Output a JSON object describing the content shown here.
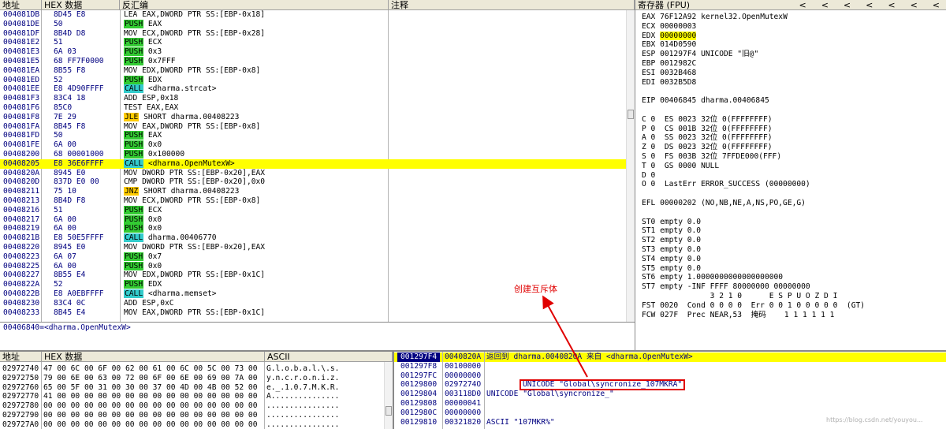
{
  "colors": {
    "highlight": "#ffff00",
    "push": "#33cc33",
    "call": "#33cccc",
    "jump": "#ffcc00",
    "changed": "#e00000",
    "annotation": "#e00000",
    "selected_stack": "#000080"
  },
  "cpu": {
    "headers": [
      "地址",
      "HEX 数据",
      "反汇编",
      "注释"
    ],
    "rows": [
      {
        "addr": "004081DB",
        "hex": "8D45 E8",
        "kw": "",
        "rest": "LEA EAX,DWORD PTR SS:[EBP-0x18]",
        "t": ""
      },
      {
        "addr": "004081DE",
        "hex": "50",
        "kw": "PUSH",
        "rest": " EAX",
        "t": "push"
      },
      {
        "addr": "004081DF",
        "hex": "8B4D D8",
        "kw": "",
        "rest": "MOV ECX,DWORD PTR SS:[EBP-0x28]",
        "t": ""
      },
      {
        "addr": "004081E2",
        "hex": "51",
        "kw": "PUSH",
        "rest": " ECX",
        "t": "push"
      },
      {
        "addr": "004081E3",
        "hex": "6A 03",
        "kw": "PUSH",
        "rest": " 0x3",
        "t": "push"
      },
      {
        "addr": "004081E5",
        "hex": "68 FF7F0000",
        "kw": "PUSH",
        "rest": " 0x7FFF",
        "t": "push"
      },
      {
        "addr": "004081EA",
        "hex": "8B55 F8",
        "kw": "",
        "rest": "MOV EDX,DWORD PTR SS:[EBP-0x8]",
        "t": ""
      },
      {
        "addr": "004081ED",
        "hex": "52",
        "kw": "PUSH",
        "rest": " EDX",
        "t": "push"
      },
      {
        "addr": "004081EE",
        "hex": "E8 4D90FFFF",
        "kw": "CALL",
        "rest": " <dharma.strcat>",
        "t": "call"
      },
      {
        "addr": "004081F3",
        "hex": "83C4 18",
        "kw": "",
        "rest": "ADD ESP,0x18",
        "t": ""
      },
      {
        "addr": "004081F6",
        "hex": "85C0",
        "kw": "",
        "rest": "TEST EAX,EAX",
        "t": ""
      },
      {
        "addr": "004081F8",
        "hex": "7E 29",
        "kw": "JLE",
        "rest": " SHORT dharma.00408223",
        "t": "jump"
      },
      {
        "addr": "004081FA",
        "hex": "8B45 F8",
        "kw": "",
        "rest": "MOV EAX,DWORD PTR SS:[EBP-0x8]",
        "t": ""
      },
      {
        "addr": "004081FD",
        "hex": "50",
        "kw": "PUSH",
        "rest": " EAX",
        "t": "push"
      },
      {
        "addr": "004081FE",
        "hex": "6A 00",
        "kw": "PUSH",
        "rest": " 0x0",
        "t": "push"
      },
      {
        "addr": "00408200",
        "hex": "68 00001000",
        "kw": "PUSH",
        "rest": " 0x100000",
        "t": "push"
      },
      {
        "addr": "00408205",
        "hex": "E8 36E6FFFF",
        "kw": "CALL",
        "rest": " <dharma.OpenMutexW>",
        "t": "call",
        "sel": true
      },
      {
        "addr": "0040820A",
        "hex": "8945 E0",
        "kw": "",
        "rest": "MOV DWORD PTR SS:[EBP-0x20],EAX",
        "t": ""
      },
      {
        "addr": "0040820D",
        "hex": "837D E0 00",
        "kw": "",
        "rest": "CMP DWORD PTR SS:[EBP-0x20],0x0",
        "t": ""
      },
      {
        "addr": "00408211",
        "hex": "75 10",
        "kw": "JNZ",
        "rest": " SHORT dharma.00408223",
        "t": "jump"
      },
      {
        "addr": "00408213",
        "hex": "8B4D F8",
        "kw": "",
        "rest": "MOV ECX,DWORD PTR SS:[EBP-0x8]",
        "t": ""
      },
      {
        "addr": "00408216",
        "hex": "51",
        "kw": "PUSH",
        "rest": " ECX",
        "t": "push"
      },
      {
        "addr": "00408217",
        "hex": "6A 00",
        "kw": "PUSH",
        "rest": " 0x0",
        "t": "push"
      },
      {
        "addr": "00408219",
        "hex": "6A 00",
        "kw": "PUSH",
        "rest": " 0x0",
        "t": "push"
      },
      {
        "addr": "0040821B",
        "hex": "E8 50E5FFFF",
        "kw": "CALL",
        "rest": " dharma.00406770",
        "t": "call"
      },
      {
        "addr": "00408220",
        "hex": "8945 E0",
        "kw": "",
        "rest": "MOV DWORD PTR SS:[EBP-0x20],EAX",
        "t": ""
      },
      {
        "addr": "00408223",
        "hex": "6A 07",
        "kw": "PUSH",
        "rest": " 0x7",
        "t": "push"
      },
      {
        "addr": "00408225",
        "hex": "6A 00",
        "kw": "PUSH",
        "rest": " 0x0",
        "t": "push"
      },
      {
        "addr": "00408227",
        "hex": "8B55 E4",
        "kw": "",
        "rest": "MOV EDX,DWORD PTR SS:[EBP-0x1C]",
        "t": ""
      },
      {
        "addr": "0040822A",
        "hex": "52",
        "kw": "PUSH",
        "rest": " EDX",
        "t": "push"
      },
      {
        "addr": "0040822B",
        "hex": "E8 A0EBFFFF",
        "kw": "CALL",
        "rest": " <dharma.memset>",
        "t": "call"
      },
      {
        "addr": "00408230",
        "hex": "83C4 0C",
        "kw": "",
        "rest": "ADD ESP,0xC",
        "t": ""
      },
      {
        "addr": "00408233",
        "hex": "8B45 E4",
        "kw": "",
        "rest": "MOV EAX,DWORD PTR SS:[EBP-0x1C]",
        "t": ""
      }
    ]
  },
  "info": {
    "text": "00406840=<dharma.OpenMutexW>"
  },
  "registers": {
    "title": "寄存器 (FPU)",
    "nav": [
      "<",
      "<",
      "<",
      "<",
      "<",
      "<",
      "<"
    ],
    "lines": [
      {
        "parts": [
          {
            "t": "EAX "
          },
          {
            "t": "76F12A92",
            "c": "changed"
          },
          {
            "t": " kernel32.OpenMutexW"
          }
        ]
      },
      {
        "parts": [
          {
            "t": "ECX 00000003"
          }
        ]
      },
      {
        "parts": [
          {
            "t": "EDX "
          },
          {
            "t": "00000000",
            "c": "hl"
          }
        ]
      },
      {
        "parts": [
          {
            "t": "EBX 014D0590"
          }
        ]
      },
      {
        "parts": [
          {
            "t": "ESP 001297F4 UNICODE \"旧@\""
          }
        ]
      },
      {
        "parts": [
          {
            "t": "EBP 0012982C"
          }
        ]
      },
      {
        "parts": [
          {
            "t": "ESI 0032B468"
          }
        ]
      },
      {
        "parts": [
          {
            "t": "EDI 0032B5D8"
          }
        ]
      },
      {
        "parts": [
          {
            "t": ""
          }
        ]
      },
      {
        "parts": [
          {
            "t": "EIP "
          },
          {
            "t": "00406845",
            "c": "changed"
          },
          {
            "t": " dharma.00406845"
          }
        ]
      },
      {
        "parts": [
          {
            "t": ""
          }
        ]
      },
      {
        "parts": [
          {
            "t": "C 0  ES 0023 32位 0(FFFFFFFF)"
          }
        ]
      },
      {
        "parts": [
          {
            "t": "P 0  CS 001B 32位 0(FFFFFFFF)"
          }
        ]
      },
      {
        "parts": [
          {
            "t": "A 0  SS 0023 32位 0(FFFFFFFF)"
          }
        ]
      },
      {
        "parts": [
          {
            "t": "Z 0  DS 0023 32位 0(FFFFFFFF)"
          }
        ]
      },
      {
        "parts": [
          {
            "t": "S 0  FS 003B 32位 7FFDE000(FFF)"
          }
        ]
      },
      {
        "parts": [
          {
            "t": "T 0  GS 0000 NULL"
          }
        ]
      },
      {
        "parts": [
          {
            "t": "D 0"
          }
        ]
      },
      {
        "parts": [
          {
            "t": "O 0  LastErr ERROR_SUCCESS (00000000)"
          }
        ]
      },
      {
        "parts": [
          {
            "t": ""
          }
        ]
      },
      {
        "parts": [
          {
            "t": "EFL 00000202 (NO,NB,NE,A,NS,PO,GE,G)"
          }
        ]
      },
      {
        "parts": [
          {
            "t": ""
          }
        ]
      },
      {
        "parts": [
          {
            "t": "ST0 empty 0.0"
          }
        ]
      },
      {
        "parts": [
          {
            "t": "ST1 empty 0.0"
          }
        ]
      },
      {
        "parts": [
          {
            "t": "ST2 empty 0.0"
          }
        ]
      },
      {
        "parts": [
          {
            "t": "ST3 empty 0.0"
          }
        ]
      },
      {
        "parts": [
          {
            "t": "ST4 empty 0.0"
          }
        ]
      },
      {
        "parts": [
          {
            "t": "ST5 empty 0.0"
          }
        ]
      },
      {
        "parts": [
          {
            "t": "ST6 empty 1.0000000000000000000"
          }
        ]
      },
      {
        "parts": [
          {
            "t": "ST7 empty -INF FFFF 80000000 00000000"
          }
        ]
      },
      {
        "parts": [
          {
            "t": "               3 2 1 0      E S P U O Z D I"
          }
        ]
      },
      {
        "parts": [
          {
            "t": "FST 0020  Cond 0 0 0 0  Err 0 0 1 0 0 0 0 0  (GT)"
          }
        ]
      },
      {
        "parts": [
          {
            "t": "FCW 027F  Prec NEAR,53  掩码    1 1 1 1 1 1"
          }
        ]
      }
    ]
  },
  "dump": {
    "headers": [
      "地址",
      "HEX 数据",
      "ASCII"
    ],
    "rows": [
      {
        "addr": "02972740",
        "hex": "47 00 6C 00 6F 00 62 00 61 00 6C 00 5C 00 73 00",
        "ascii": "G.l.o.b.a.l.\\.s."
      },
      {
        "addr": "02972750",
        "hex": "79 00 6E 00 63 00 72 00 6F 00 6E 00 69 00 7A 00",
        "ascii": "y.n.c.r.o.n.i.z."
      },
      {
        "addr": "02972760",
        "hex": "65 00 5F 00 31 00 30 00 37 00 4D 00 4B 00 52 00",
        "ascii": "e._.1.0.7.M.K.R."
      },
      {
        "addr": "02972770",
        "hex": "41 00 00 00 00 00 00 00 00 00 00 00 00 00 00 00",
        "ascii": "A..............."
      },
      {
        "addr": "02972780",
        "hex": "00 00 00 00 00 00 00 00 00 00 00 00 00 00 00 00",
        "ascii": "................"
      },
      {
        "addr": "02972790",
        "hex": "00 00 00 00 00 00 00 00 00 00 00 00 00 00 00 00",
        "ascii": "................"
      },
      {
        "addr": "029727A0",
        "hex": "00 00 00 00 00 00 00 00 00 00 00 00 00 00 00 00",
        "ascii": "................"
      }
    ]
  },
  "stack": {
    "rows": [
      {
        "addr": "001297F4",
        "val": "0040820A",
        "cmt": "返回到 dharma.0040820A 来自 <dharma.OpenMutexW>",
        "sel": true
      },
      {
        "addr": "001297F8",
        "val": "00100000",
        "cmt": ""
      },
      {
        "addr": "001297FC",
        "val": "00000000",
        "cmt": ""
      },
      {
        "addr": "00129800",
        "val": "0297274O",
        "cmt": "UNICODE \"Global\\syncronize_107MKRA\"",
        "box": true
      },
      {
        "addr": "00129804",
        "val": "003118D0",
        "cmt": "UNICODE \"Global\\syncronize_\""
      },
      {
        "addr": "00129808",
        "val": "00000041",
        "cmt": ""
      },
      {
        "addr": "0012980C",
        "val": "00000000",
        "cmt": ""
      },
      {
        "addr": "00129810",
        "val": "00321820",
        "cmt": "ASCII \"107MKR%\""
      }
    ]
  },
  "annotation": {
    "text": "创建互斥体"
  },
  "watermark": {
    "text": "https://blog.csdn.net/youyou..."
  }
}
